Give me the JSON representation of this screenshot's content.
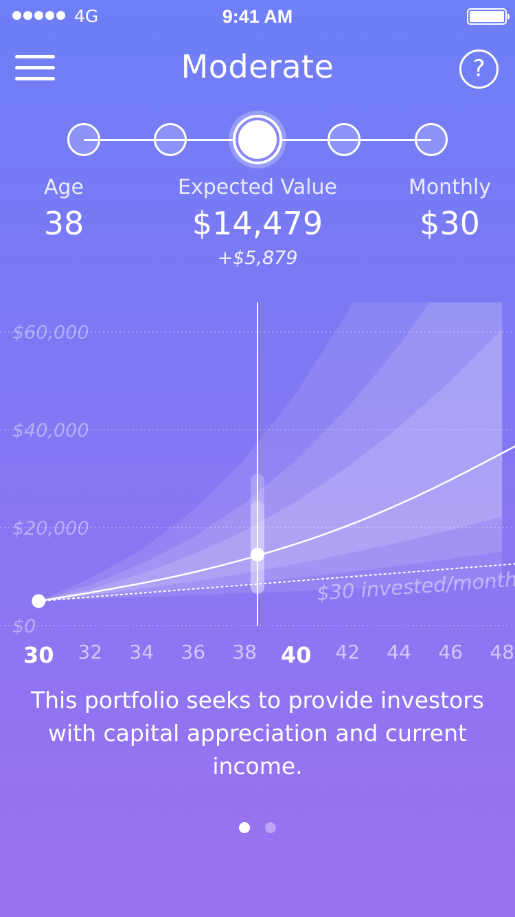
{
  "status_bar": {
    "carrier": "4G",
    "time": "9:41 AM"
  },
  "header": {
    "title": "Moderate",
    "help_label": "?",
    "menu_icon": "hamburger-menu-icon"
  },
  "risk_selector": {
    "levels": 5,
    "selected_index": 2
  },
  "stats": {
    "age_label": "Age",
    "age_value": "38",
    "expected_label": "Expected Value",
    "expected_value": "$14,479",
    "expected_change": "+$5,879",
    "monthly_label": "Monthly",
    "monthly_value": "$30"
  },
  "chart_data": {
    "type": "area",
    "yticks": [
      "$0",
      "$20,000",
      "$40,000",
      "$60,000"
    ],
    "ylim": [
      0,
      66000
    ],
    "xlim": [
      28.5,
      48.5
    ],
    "xticks": [
      "30",
      "32",
      "34",
      "36",
      "38",
      "40",
      "42",
      "44",
      "46",
      "48"
    ],
    "major_xticks": [
      "30",
      "40"
    ],
    "cursor_age": 38.5,
    "cursor_value": 14479,
    "start": {
      "age": 30,
      "value": 5000
    },
    "expected_series": {
      "x": [
        30,
        32,
        34,
        36,
        38,
        40,
        42,
        44,
        46,
        48
      ],
      "y": [
        5000,
        6700,
        8600,
        10800,
        13500,
        16600,
        20300,
        24700,
        29700,
        35200
      ]
    },
    "invested_series": {
      "label": "$30 invested/month",
      "x": [
        30,
        48
      ],
      "y": [
        5000,
        12500
      ]
    },
    "bands": [
      {
        "upper": [
          5000,
          9600,
          15500,
          23500,
          34000,
          47500,
          64000,
          84000,
          108000,
          136000
        ],
        "lower": [
          5000,
          5400,
          5800,
          6200,
          6600,
          7000,
          7400,
          7900,
          8400,
          9000
        ]
      },
      {
        "upper": [
          5000,
          8300,
          12600,
          18000,
          25000,
          33800,
          44500,
          57200,
          72000,
          89000
        ],
        "lower": [
          5000,
          5800,
          6700,
          7600,
          8600,
          9700,
          10900,
          12200,
          13600,
          15100
        ]
      },
      {
        "upper": [
          5000,
          7400,
          10600,
          14500,
          19400,
          25300,
          32400,
          40600,
          50000,
          60500
        ],
        "lower": [
          5000,
          6200,
          7500,
          9000,
          10700,
          12600,
          14700,
          17000,
          19500,
          22200
        ]
      }
    ],
    "grid": true
  },
  "description": "This portfolio seeks to provide investors with capital appreciation and current income.",
  "pagination": {
    "pages": 2,
    "current": 0
  }
}
